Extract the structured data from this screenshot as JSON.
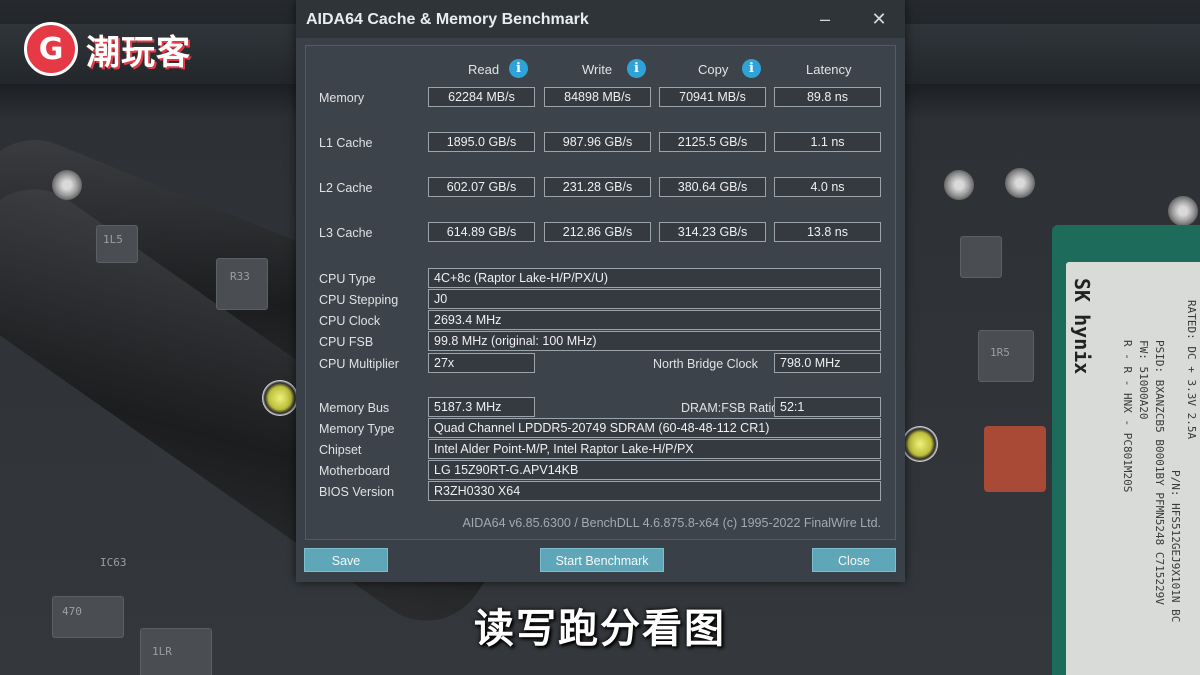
{
  "watermark": {
    "mark": "G",
    "text": "潮玩客"
  },
  "subtitle": "读写跑分看图",
  "background": {
    "chips": [
      "R33",
      "1L5",
      "470",
      "1LR",
      "IC63",
      "1R5"
    ],
    "ssd_brand": "SK hynix",
    "ssd_text": [
      "RATED: DC + 3.3V 2.5A",
      "P/N: HFS512GEJ9X101N BC",
      "PSID: BXANZCB5 B0001BY PFMN5248 C715229V",
      "FW: 51000A20",
      "R - R - HNX - PC801M20S"
    ]
  },
  "window": {
    "title": "AIDA64 Cache & Memory Benchmark",
    "minimize_glyph": "–",
    "close_glyph": "✕",
    "columns": [
      "Read",
      "Write",
      "Copy",
      "Latency"
    ],
    "info_glyph": "i",
    "bench_rows": [
      {
        "label": "Memory",
        "read": "62284 MB/s",
        "write": "84898 MB/s",
        "copy": "70941 MB/s",
        "latency": "89.8 ns"
      },
      {
        "label": "L1 Cache",
        "read": "1895.0 GB/s",
        "write": "987.96 GB/s",
        "copy": "2125.5 GB/s",
        "latency": "1.1 ns"
      },
      {
        "label": "L2 Cache",
        "read": "602.07 GB/s",
        "write": "231.28 GB/s",
        "copy": "380.64 GB/s",
        "latency": "4.0 ns"
      },
      {
        "label": "L3 Cache",
        "read": "614.89 GB/s",
        "write": "212.86 GB/s",
        "copy": "314.23 GB/s",
        "latency": "13.8 ns"
      }
    ],
    "cpu": {
      "type_label": "CPU Type",
      "type": "4C+8c   (Raptor Lake-H/P/PX/U)",
      "stepping_label": "CPU Stepping",
      "stepping": "J0",
      "clock_label": "CPU Clock",
      "clock": "2693.4 MHz",
      "fsb_label": "CPU FSB",
      "fsb": "99.8 MHz  (original: 100 MHz)",
      "multiplier_label": "CPU Multiplier",
      "multiplier": "27x",
      "nb_clock_label": "North Bridge Clock",
      "nb_clock": "798.0 MHz"
    },
    "memory": {
      "bus_label": "Memory Bus",
      "bus": "5187.3 MHz",
      "ratio_label": "DRAM:FSB Ratio",
      "ratio": "52:1",
      "type_label": "Memory Type",
      "type": "Quad Channel LPDDR5-20749 SDRAM  (60-48-48-112 CR1)",
      "chipset_label": "Chipset",
      "chipset": "Intel Alder Point-M/P, Intel Raptor Lake-H/P/PX",
      "motherboard_label": "Motherboard",
      "motherboard": "LG 15Z90RT-G.APV14KB",
      "bios_label": "BIOS Version",
      "bios": "R3ZH0330 X64"
    },
    "footer": "AIDA64 v6.85.6300 / BenchDLL 4.6.875.8-x64  (c) 1995-2022 FinalWire Ltd.",
    "buttons": {
      "save": "Save",
      "start": "Start Benchmark",
      "close": "Close"
    }
  }
}
